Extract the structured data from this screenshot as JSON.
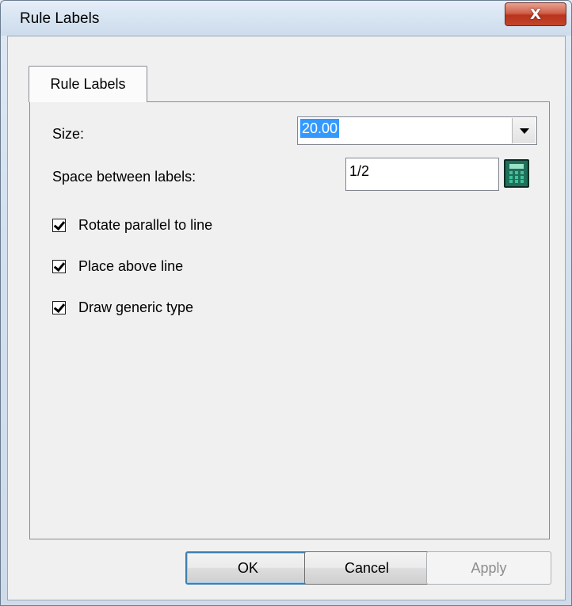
{
  "window": {
    "title": "Rule Labels",
    "close_glyph": "X",
    "close_icon": "close-icon"
  },
  "tabs": [
    {
      "label": "Rule Labels",
      "active": true
    }
  ],
  "form": {
    "size": {
      "label": "Size:",
      "value": "20.00",
      "dropdown_icon": "chevron-down-icon"
    },
    "spacing": {
      "label": "Space between labels:",
      "value": "1/2",
      "calculator_icon": "calculator-icon"
    },
    "options": [
      {
        "label": "Rotate parallel to line",
        "checked": true
      },
      {
        "label": "Place above line",
        "checked": true
      },
      {
        "label": "Draw generic type",
        "checked": true
      }
    ]
  },
  "buttons": {
    "ok": "OK",
    "cancel": "Cancel",
    "apply": "Apply"
  },
  "colors": {
    "selection": "#3399ff",
    "close_button": "#c2462b",
    "default_button_border": "#3c7fb1",
    "disabled_text": "#8d8d8d"
  }
}
